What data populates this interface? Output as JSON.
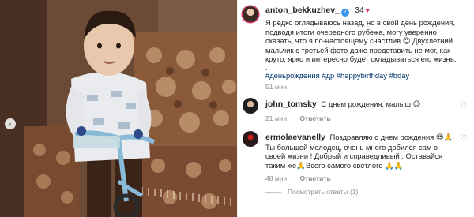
{
  "post": {
    "author": "anton_bekkuzhev_",
    "likes": "34",
    "caption": "Я редко оглядываюсь назад, но в свой день рождения, подводя итоги очередного рубежа, могу уверенно сказать, что я по-настоящему счастлив 😉 Двухлетний мальчик с третьей фото даже представить не мог, как круто, ярко и интересно будет складываться его жизнь.",
    "dot": ".",
    "hashtags": "#деньрождения #др #happybirthday #bday",
    "time": "51 мин."
  },
  "comments": [
    {
      "author": "john_tomsky",
      "text": "С днем рождения, малыш 😉",
      "time": "21 мин.",
      "reply_label": "Ответить"
    },
    {
      "author": "ermolaevanelly",
      "text": "Поздравляю с днем рождения 😍🙏 Ты большой молодец, очень много добился сам в своей жизни ! Добрый и справедливый . Оставайся таким же🙏Всего самого светлого 🙏🙏",
      "time": "48 мин.",
      "reply_label": "Ответить",
      "more_replies": "Посмотреть ответы (1)"
    }
  ],
  "icons": {
    "verified": "verified-badge-icon",
    "like": "heart-icon",
    "prev": "chevron-left-icon"
  },
  "colors": {
    "link": "#00376b",
    "verified": "#3897f0",
    "muted": "#8e8e8e"
  }
}
